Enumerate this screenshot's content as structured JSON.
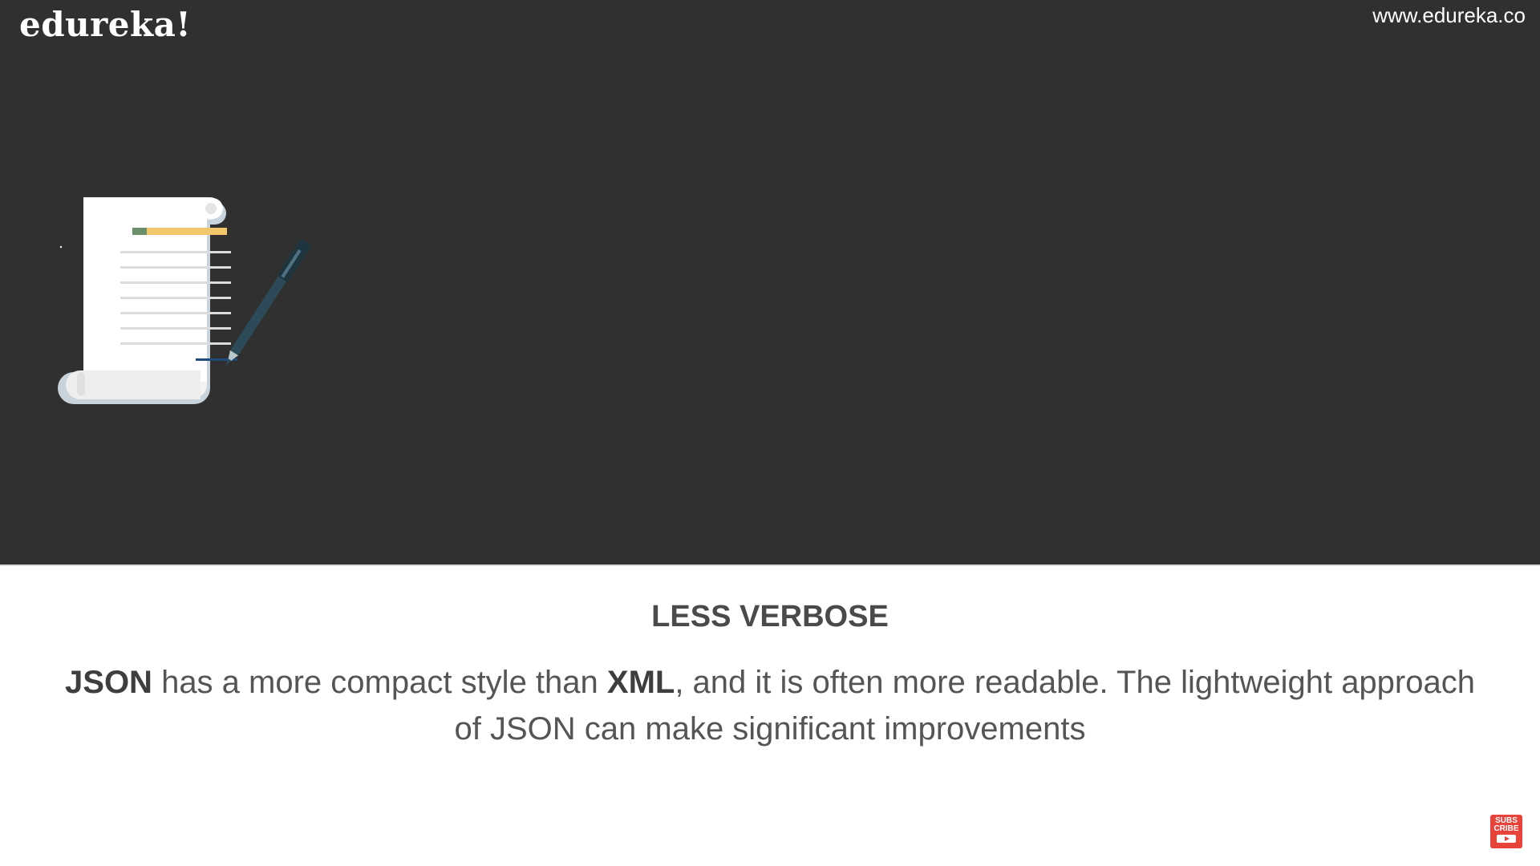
{
  "header": {
    "logo_text": "edureka!",
    "site_url": "www.edureka.co"
  },
  "illustration": {
    "icon": "document-with-pen-icon"
  },
  "content": {
    "heading": "LESS VERBOSE",
    "body": {
      "part1": "JSON",
      "part2": " has a more compact style than ",
      "part3": "XML",
      "part4": ", and it is often more readable. The lightweight approach of JSON can make significant improvements"
    }
  },
  "subscribe": {
    "line1": "SUBS",
    "line2": "CRIBE"
  },
  "colors": {
    "panel_bg": "#303030",
    "text": "#555555",
    "subscribe": "#e8433a"
  }
}
